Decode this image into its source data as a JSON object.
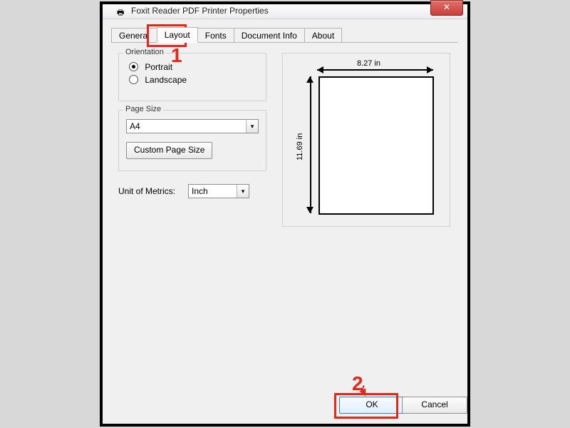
{
  "window": {
    "title": "Foxit Reader PDF Printer Properties",
    "close_glyph": "✕"
  },
  "tabs": {
    "general": "General",
    "layout": "Layout",
    "fonts": "Fonts",
    "docinfo": "Document Info",
    "about": "About"
  },
  "orientation": {
    "legend": "Orientation",
    "portrait": "Portrait",
    "landscape": "Landscape",
    "selected": "portrait"
  },
  "page_size": {
    "legend": "Page Size",
    "value": "A4",
    "custom_btn": "Custom Page Size"
  },
  "metrics": {
    "label": "Unit of Metrics:",
    "value": "Inch"
  },
  "preview": {
    "width_label": "8.27 in",
    "height_label": "11.69 in"
  },
  "buttons": {
    "ok": "OK",
    "cancel": "Cancel"
  },
  "annotations": {
    "n1": "1",
    "n2": "2"
  },
  "glyphs": {
    "dropdown": "▾",
    "printer": "🖶"
  }
}
